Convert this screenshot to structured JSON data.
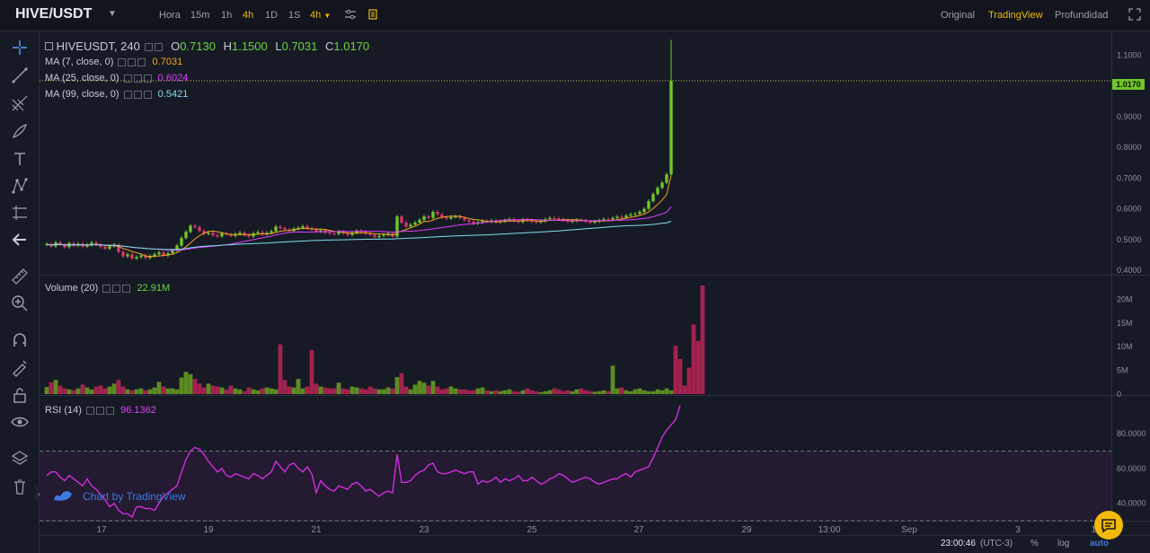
{
  "header": {
    "symbol": "HIVE/USDT",
    "timeframes": [
      {
        "label": "Hora",
        "active": false
      },
      {
        "label": "15m",
        "active": false
      },
      {
        "label": "1h",
        "active": false
      },
      {
        "label": "4h",
        "active": true
      },
      {
        "label": "1D",
        "active": false
      },
      {
        "label": "1S",
        "active": false
      }
    ],
    "interval_select": "4h",
    "views": [
      {
        "label": "Original",
        "active": false
      },
      {
        "label": "TradingView",
        "active": true
      },
      {
        "label": "Profundidad",
        "active": false
      }
    ]
  },
  "icons": {
    "toolbar": [
      "indicators-icon",
      "chart-style-icon"
    ],
    "left": [
      "crosshair-icon",
      "trendline-icon",
      "fib-icon",
      "brush-icon",
      "text-icon",
      "pattern-icon",
      "measure-icon",
      "back-arrow-icon",
      "ruler-icon",
      "zoom-icon",
      "magnet-icon",
      "lock-drawings-icon",
      "unlock-icon",
      "eye-icon",
      "layers-icon",
      "trash-icon"
    ]
  },
  "legend": {
    "title": "HIVEUSDT, 240",
    "ohlc": [
      {
        "label": "O",
        "value": "0.7130"
      },
      {
        "label": "H",
        "value": "1.1500"
      },
      {
        "label": "L",
        "value": "0.7031"
      },
      {
        "label": "C",
        "value": "1.0170"
      }
    ],
    "ma": [
      {
        "label": "MA (7, close, 0)",
        "value": "0.7031",
        "color": "#f5a623"
      },
      {
        "label": "MA (25, close, 0)",
        "value": "0.6024",
        "color": "#e040fb"
      },
      {
        "label": "MA (99, close, 0)",
        "value": "0.5421",
        "color": "#80deea"
      }
    ],
    "volume": {
      "label": "Volume (20)",
      "value": "22.91M"
    },
    "rsi": {
      "label": "RSI (14)",
      "value": "96.1362"
    }
  },
  "chart_data": {
    "type": "candlestick",
    "price_axis": {
      "ticks": [
        "1.1000",
        "1.0000",
        "0.9000",
        "0.8000",
        "0.7000",
        "0.6000",
        "0.5000",
        "0.4000"
      ],
      "ylim": [
        0.4,
        1.16
      ],
      "last_price": "1.0170"
    },
    "volume_axis": {
      "ticks": [
        "20M",
        "15M",
        "10M",
        "5M",
        "0"
      ],
      "ylim": [
        0,
        22.91
      ]
    },
    "rsi_axis": {
      "ticks": [
        "80.0000",
        "60.0000",
        "40.0000"
      ],
      "ylim": [
        30,
        97
      ],
      "levels": [
        70,
        30
      ]
    },
    "x_ticks": [
      "17",
      "19",
      "21",
      "23",
      "25",
      "27",
      "29",
      "13:00",
      "Sep",
      "3",
      "13"
    ],
    "candle_close": [
      0.485,
      0.478,
      0.49,
      0.482,
      0.475,
      0.488,
      0.48,
      0.486,
      0.477,
      0.482,
      0.49,
      0.483,
      0.476,
      0.47,
      0.478,
      0.483,
      0.46,
      0.445,
      0.452,
      0.438,
      0.443,
      0.448,
      0.44,
      0.446,
      0.452,
      0.458,
      0.448,
      0.455,
      0.465,
      0.48,
      0.505,
      0.525,
      0.545,
      0.54,
      0.528,
      0.518,
      0.522,
      0.514,
      0.51,
      0.52,
      0.516,
      0.512,
      0.518,
      0.522,
      0.514,
      0.51,
      0.52,
      0.524,
      0.517,
      0.522,
      0.527,
      0.542,
      0.537,
      0.532,
      0.528,
      0.535,
      0.538,
      0.543,
      0.536,
      0.532,
      0.526,
      0.53,
      0.522,
      0.52,
      0.518,
      0.525,
      0.52,
      0.515,
      0.522,
      0.528,
      0.524,
      0.519,
      0.515,
      0.508,
      0.512,
      0.515,
      0.52,
      0.51,
      0.575,
      0.555,
      0.542,
      0.548,
      0.555,
      0.564,
      0.575,
      0.57,
      0.59,
      0.582,
      0.572,
      0.568,
      0.573,
      0.575,
      0.57,
      0.563,
      0.558,
      0.552,
      0.556,
      0.56,
      0.558,
      0.562,
      0.556,
      0.559,
      0.562,
      0.566,
      0.56,
      0.557,
      0.565,
      0.562,
      0.558,
      0.556,
      0.56,
      0.566,
      0.57,
      0.568,
      0.566,
      0.562,
      0.558,
      0.56,
      0.564,
      0.562,
      0.558,
      0.555,
      0.558,
      0.562,
      0.566,
      0.565,
      0.57,
      0.574,
      0.572,
      0.578,
      0.582,
      0.584,
      0.59,
      0.6,
      0.625,
      0.648,
      0.668,
      0.685,
      0.712,
      1.017
    ],
    "volume_m": [
      1.5,
      2.5,
      3.0,
      1.8,
      1.2,
      1.0,
      0.8,
      1.2,
      2.0,
      1.4,
      1.0,
      1.6,
      1.8,
      1.2,
      1.6,
      2.2,
      3.0,
      1.6,
      1.0,
      0.8,
      1.0,
      1.2,
      0.8,
      1.0,
      1.4,
      2.6,
      1.6,
      1.2,
      1.2,
      1.0,
      3.5,
      4.7,
      4.2,
      3.2,
      2.2,
      1.4,
      2.2,
      1.8,
      1.6,
      1.4,
      1.0,
      1.8,
      1.2,
      1.0,
      0.6,
      1.4,
      1.0,
      0.8,
      1.2,
      1.4,
      1.2,
      1.0,
      10.5,
      3.0,
      1.6,
      1.4,
      3.2,
      1.2,
      1.6,
      9.3,
      2.2,
      1.6,
      1.4,
      1.2,
      1.2,
      2.4,
      1.2,
      1.0,
      1.6,
      1.4,
      1.2,
      1.0,
      1.6,
      1.2,
      1.0,
      1.0,
      1.4,
      1.2,
      3.6,
      4.4,
      1.6,
      1.0,
      2.0,
      2.8,
      2.4,
      1.8,
      2.8,
      1.6,
      1.0,
      1.2,
      1.6,
      1.2,
      1.0,
      1.0,
      0.8,
      0.8,
      1.2,
      1.4,
      0.8,
      0.6,
      0.8,
      0.6,
      0.8,
      1.0,
      0.6,
      0.5,
      0.8,
      1.2,
      0.8,
      0.6,
      0.4,
      0.6,
      0.8,
      1.2,
      1.0,
      0.6,
      0.8,
      0.6,
      1.0,
      1.2,
      0.8,
      0.6,
      0.5,
      0.6,
      0.8,
      0.6,
      6.0,
      1.2,
      1.4,
      0.8,
      0.6,
      1.0,
      1.2,
      0.8,
      0.6,
      0.6,
      1.0,
      0.8,
      1.2,
      0.8,
      10.2,
      7.4,
      1.8,
      5.6,
      14.7,
      11.2,
      22.9
    ],
    "rsi": [
      56,
      58,
      58,
      55,
      53,
      56,
      54,
      52,
      50,
      54,
      50,
      48,
      45,
      42,
      38,
      40,
      36,
      34,
      34,
      32,
      38,
      38,
      37,
      37,
      36,
      40,
      44,
      46,
      48,
      50,
      58,
      65,
      70,
      72,
      71,
      68,
      64,
      61,
      58,
      60,
      56,
      55,
      57,
      56,
      55,
      54,
      57,
      56,
      54,
      56,
      58,
      64,
      61,
      58,
      62,
      63,
      60,
      58,
      61,
      57,
      46,
      53,
      50,
      48,
      47,
      50,
      49,
      48,
      51,
      52,
      50,
      47,
      48,
      46,
      44,
      46,
      47,
      46,
      68,
      52,
      52,
      53,
      56,
      58,
      59,
      62,
      63,
      58,
      57,
      57,
      58,
      59,
      58,
      57,
      58,
      58,
      51,
      53,
      52,
      53,
      55,
      52,
      54,
      53,
      54,
      56,
      53,
      53,
      55,
      53,
      51,
      52,
      54,
      55,
      57,
      56,
      54,
      52,
      53,
      54,
      55,
      54,
      52,
      51,
      52,
      53,
      54,
      54,
      56,
      57,
      55,
      58,
      59,
      60,
      61,
      66,
      72,
      78,
      82,
      85,
      88,
      96.1
    ]
  },
  "branding": {
    "text": "Chart by TradingView"
  },
  "footer": {
    "time": "23:00:46",
    "timezone": "(UTC-3)",
    "percent": "%",
    "log": "log",
    "auto": "auto"
  }
}
